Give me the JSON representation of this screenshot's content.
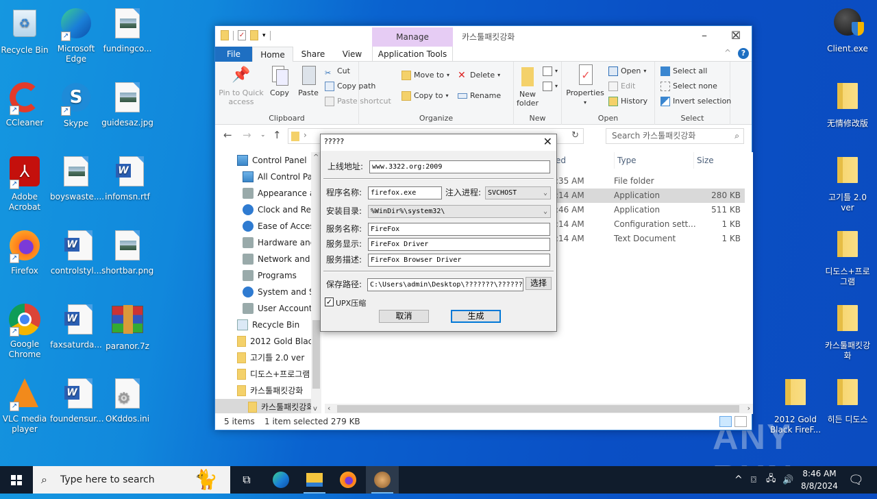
{
  "desktop": {
    "left_icons": [
      {
        "label": "Recycle Bin",
        "icon": "recycle-bin-icon"
      },
      {
        "label": "Microsoft Edge",
        "icon": "edge-icon"
      },
      {
        "label": "fundingco...",
        "icon": "image-file-icon"
      },
      {
        "label": "CCleaner",
        "icon": "ccleaner-icon"
      },
      {
        "label": "Skype",
        "icon": "skype-icon"
      },
      {
        "label": "guidesaz.jpg",
        "icon": "image-file-icon"
      },
      {
        "label": "Adobe Acrobat",
        "icon": "acrobat-icon"
      },
      {
        "label": "boyswaste....",
        "icon": "image-file-icon"
      },
      {
        "label": "infomsn.rtf",
        "icon": "word-doc-icon"
      },
      {
        "label": "Firefox",
        "icon": "firefox-icon"
      },
      {
        "label": "controlstyl...",
        "icon": "word-doc-icon"
      },
      {
        "label": "shortbar.png",
        "icon": "image-file-icon"
      },
      {
        "label": "Google Chrome",
        "icon": "chrome-icon"
      },
      {
        "label": "faxsaturda...",
        "icon": "word-doc-icon"
      },
      {
        "label": "paranor.7z",
        "icon": "winrar-archive-icon"
      },
      {
        "label": "VLC media player",
        "icon": "vlc-icon"
      },
      {
        "label": "foundensur...",
        "icon": "word-doc-icon"
      },
      {
        "label": "OKddos.ini",
        "icon": "config-file-icon"
      }
    ],
    "right_icons": [
      {
        "label": "Client.exe",
        "icon": "client-exe-icon"
      },
      {
        "label": "无情修改版",
        "icon": "folder-icon"
      },
      {
        "label": "고기틀 2.0 ver",
        "icon": "folder-icon"
      },
      {
        "label": "디도스+프로그램",
        "icon": "folder-icon"
      },
      {
        "label": "카스툴패킷강화",
        "icon": "folder-icon"
      },
      {
        "label": "2012 Gold Black FireF...",
        "icon": "folder-icon"
      },
      {
        "label": "히든 디도스",
        "icon": "folder-icon"
      }
    ],
    "watermark": "ANY RUN"
  },
  "explorer": {
    "title": "카스툴패킷강화",
    "manage_label": "Manage",
    "tabs": {
      "file": "File",
      "home": "Home",
      "share": "Share",
      "view": "View",
      "app_tools": "Application Tools"
    },
    "ribbon": {
      "clipboard": {
        "label": "Clipboard",
        "pin": "Pin to Quick access",
        "copy": "Copy",
        "paste": "Paste",
        "cut": "Cut",
        "copy_path": "Copy path",
        "paste_shortcut": "Paste shortcut"
      },
      "organize": {
        "label": "Organize",
        "move_to": "Move to",
        "copy_to": "Copy to",
        "delete": "Delete",
        "rename": "Rename"
      },
      "new": {
        "label": "New",
        "new_folder": "New folder"
      },
      "open": {
        "label": "Open",
        "properties": "Properties",
        "open": "Open",
        "edit": "Edit",
        "history": "History"
      },
      "select": {
        "label": "Select",
        "select_all": "Select all",
        "select_none": "Select none",
        "invert": "Invert selection"
      }
    },
    "search_placeholder": "Search 카스툴패킷강화",
    "nav_tree": [
      {
        "label": "Control Panel",
        "icon": "control-panel-icon",
        "indent": 0
      },
      {
        "label": "All Control Par",
        "icon": "control-panel-icon",
        "indent": 1
      },
      {
        "label": "Appearance an",
        "icon": "appearance-icon",
        "indent": 1
      },
      {
        "label": "Clock and Regi",
        "icon": "clock-icon",
        "indent": 1
      },
      {
        "label": "Ease of Access",
        "icon": "ease-of-access-icon",
        "indent": 1
      },
      {
        "label": "Hardware and",
        "icon": "hardware-icon",
        "indent": 1
      },
      {
        "label": "Network and Ir",
        "icon": "network-icon",
        "indent": 1
      },
      {
        "label": "Programs",
        "icon": "programs-icon",
        "indent": 1
      },
      {
        "label": "System and Se",
        "icon": "system-security-icon",
        "indent": 1
      },
      {
        "label": "User Accounts",
        "icon": "user-accounts-icon",
        "indent": 1
      },
      {
        "label": "Recycle Bin",
        "icon": "recycle-bin-icon",
        "indent": 0
      },
      {
        "label": "2012 Gold Black",
        "icon": "folder-icon",
        "indent": 0
      },
      {
        "label": "고기틀 2.0 ver",
        "icon": "folder-icon",
        "indent": 0
      },
      {
        "label": "디도스+프로그램",
        "icon": "folder-icon",
        "indent": 0
      },
      {
        "label": "카스툴패킷강화",
        "icon": "folder-icon",
        "indent": 0
      },
      {
        "label": "카스툴패킷강화",
        "icon": "folder-icon",
        "indent": 1,
        "selected": true
      }
    ],
    "columns": {
      "modified": "ed",
      "type": "Type",
      "size": "Size"
    },
    "rows": [
      {
        "modified": ":35 AM",
        "type": "File folder",
        "size": ""
      },
      {
        "modified": ":14 AM",
        "type": "Application",
        "size": "280 KB",
        "selected": true
      },
      {
        "modified": ":46 AM",
        "type": "Application",
        "size": "511 KB"
      },
      {
        "modified": ":14 AM",
        "type": "Configuration sett...",
        "size": "1 KB"
      },
      {
        "modified": ":14 AM",
        "type": "Text Document",
        "size": "1 KB"
      }
    ],
    "status": {
      "items": "5 items",
      "selected": "1 item selected  279 KB"
    }
  },
  "dialog": {
    "title": "?????",
    "online_addr_label": "上线地址:",
    "online_addr": "www.3322.org:2009",
    "program_name_label": "程序名称:",
    "program_name": "firefox.exe",
    "inject_label": "注入进程:",
    "inject_value": "SVCHOST",
    "install_dir_label": "安装目录:",
    "install_dir": "%WinDir%\\system32\\",
    "service_name_label": "服务名称:",
    "service_name": "FireFox",
    "service_display_label": "服务显示:",
    "service_display": "FireFox Driver",
    "service_desc_label": "服务描述:",
    "service_desc": "FireFox Browser Driver",
    "save_path_label": "保存路径:",
    "save_path": "C:\\Users\\admin\\Desktop\\???????\\??????",
    "choose_label": "选择",
    "upx_label": "UPX压缩",
    "upx_checked": true,
    "cancel_label": "取消",
    "generate_label": "生成"
  },
  "taskbar": {
    "search_placeholder": "Type here to search",
    "time": "8:46 AM",
    "date": "8/8/2024"
  }
}
